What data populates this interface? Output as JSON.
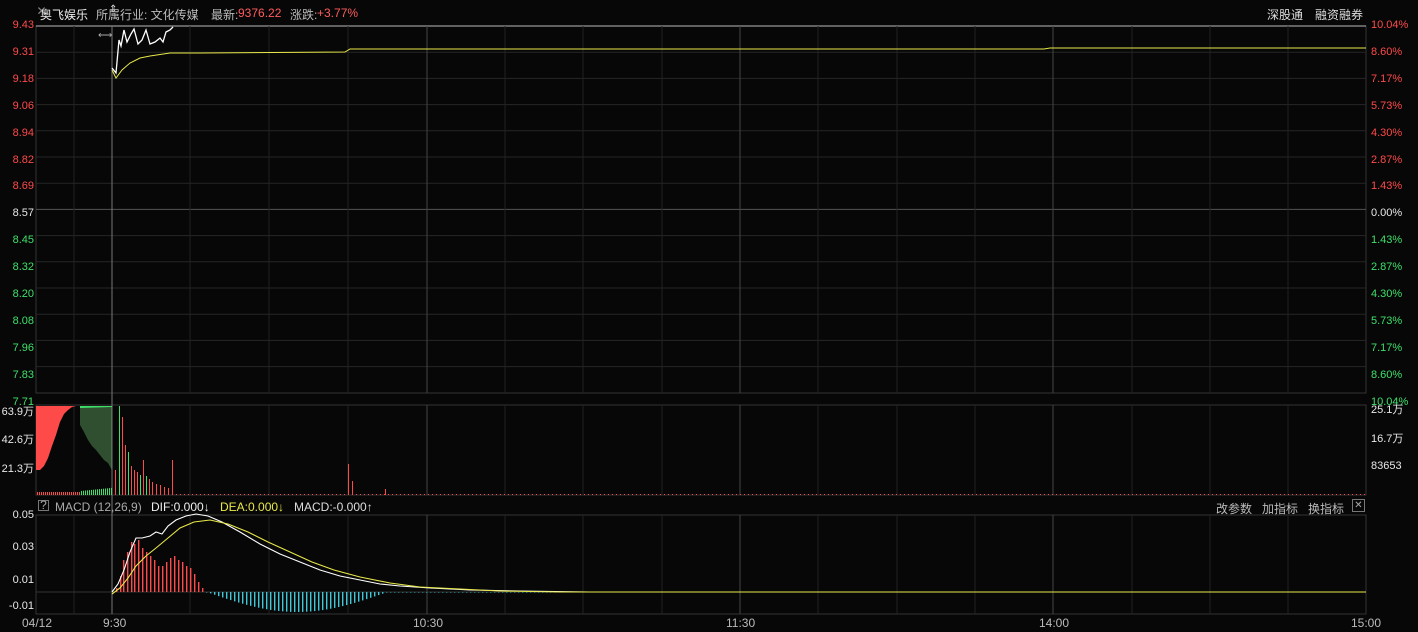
{
  "header": {
    "stock_name": "奥飞娱乐",
    "industry_label": "所属行业: 文化传媒",
    "latest_label": "最新:",
    "latest_value": "9376.22",
    "change_label": "涨跌:",
    "change_value": "+3.77%",
    "flags": [
      "深股通",
      "融资融券"
    ],
    "close_icon": "close-icon"
  },
  "price_axis": {
    "left": [
      "9.43",
      "9.31",
      "9.18",
      "9.06",
      "8.94",
      "8.82",
      "8.69",
      "8.57",
      "8.45",
      "8.32",
      "8.20",
      "8.08",
      "7.96",
      "7.83",
      "7.71"
    ],
    "right": [
      "10.04%",
      "8.60%",
      "7.17%",
      "5.73%",
      "4.30%",
      "2.87%",
      "1.43%",
      "0.00%",
      "1.43%",
      "2.87%",
      "4.30%",
      "5.73%",
      "7.17%",
      "8.60%",
      "10.04%"
    ]
  },
  "volume_axis": {
    "left": [
      "63.9万",
      "42.6万",
      "21.3万"
    ],
    "right": [
      "25.1万",
      "16.7万",
      "83653"
    ]
  },
  "macd": {
    "help_icon": "help-icon",
    "name": "MACD (12,26,9)",
    "dif": "DIF:0.000↓",
    "dea": "DEA:0.000↓",
    "macd": "MACD:-0.000↑",
    "buttons": [
      "改参数",
      "加指标",
      "换指标"
    ],
    "close_icon": "close-icon",
    "axis": [
      "0.05",
      "0.03",
      "0.01",
      "-0.01"
    ]
  },
  "time_axis": [
    "04/12",
    "9:30",
    "10:30",
    "11:30",
    "14:00",
    "15:00"
  ],
  "colors": {
    "up": "#ff4a4a",
    "down": "#3ee06a",
    "price_line": "#ffffff",
    "avg_line": "#e8e84a",
    "macd_neg": "#40c8d8",
    "grid": "#2a2a2a"
  }
}
